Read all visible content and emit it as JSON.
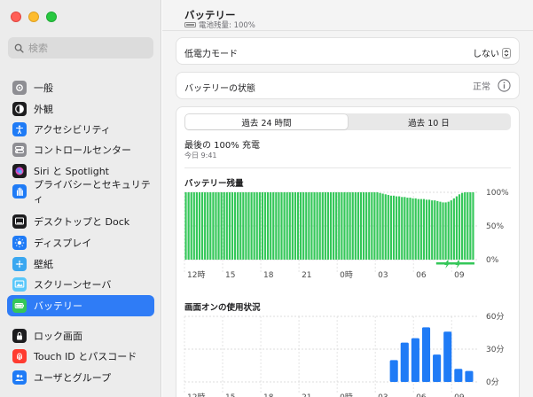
{
  "sidebar": {
    "search_placeholder": "検索",
    "items": [
      {
        "label": "一般",
        "icon": "gear-icon",
        "color": "#8e8e93"
      },
      {
        "label": "外観",
        "icon": "appearance-icon",
        "color": "#1d1d1f"
      },
      {
        "label": "アクセシビリティ",
        "icon": "accessibility-icon",
        "color": "#1f7bf6"
      },
      {
        "label": "コントロールセンター",
        "icon": "control-center-icon",
        "color": "#8e8e93"
      },
      {
        "label": "Siri と Spotlight",
        "icon": "siri-icon",
        "color": "#b03bd9"
      },
      {
        "label": "プライバシーとセキュリティ",
        "icon": "hand-icon",
        "color": "#1f7bf6"
      },
      {
        "label": "デスクトップと Dock",
        "icon": "dock-icon",
        "color": "#1d1d1f"
      },
      {
        "label": "ディスプレイ",
        "icon": "display-icon",
        "color": "#1f7bf6"
      },
      {
        "label": "壁紙",
        "icon": "wallpaper-icon",
        "color": "#3aa7f0"
      },
      {
        "label": "スクリーンセーバ",
        "icon": "screensaver-icon",
        "color": "#5ac8fa"
      },
      {
        "label": "バッテリー",
        "icon": "battery-icon",
        "color": "#34c759",
        "active": true
      },
      {
        "label": "ロック画面",
        "icon": "lock-icon",
        "color": "#1d1d1f"
      },
      {
        "label": "Touch ID とパスコード",
        "icon": "fingerprint-icon",
        "color": "#ff3b30"
      },
      {
        "label": "ユーザとグループ",
        "icon": "users-icon",
        "color": "#1f7bf6"
      }
    ]
  },
  "header": {
    "title": "バッテリー",
    "subtitle": "電池残量: 100%"
  },
  "low_power": {
    "label": "低電力モード",
    "value": "しない"
  },
  "health": {
    "label": "バッテリーの状態",
    "value": "正常"
  },
  "tabs": [
    "過去 24 時間",
    "過去 10 日"
  ],
  "last_charge": {
    "label": "最後の 100% 充電",
    "time": "今日 9:41"
  },
  "chart_data": [
    {
      "type": "bar",
      "title": "バッテリー残量",
      "x_tick_labels": [
        "12時",
        "15",
        "18",
        "21",
        "0時",
        "03",
        "06",
        "09"
      ],
      "y_tick_labels": [
        "100%",
        "50%",
        "0%"
      ],
      "ylim": [
        0,
        100
      ],
      "color": "#34c759",
      "charging_color": "#34c759",
      "values": [
        100,
        100,
        100,
        100,
        100,
        100,
        100,
        100,
        100,
        100,
        100,
        100,
        100,
        100,
        100,
        100,
        100,
        100,
        100,
        100,
        100,
        100,
        100,
        100,
        100,
        100,
        100,
        100,
        100,
        100,
        100,
        100,
        100,
        100,
        100,
        100,
        100,
        100,
        100,
        100,
        100,
        100,
        100,
        100,
        100,
        100,
        100,
        100,
        100,
        100,
        100,
        100,
        100,
        100,
        100,
        100,
        100,
        100,
        100,
        100,
        100,
        100,
        100,
        100,
        100,
        100,
        100,
        100,
        100,
        100,
        100,
        99,
        98,
        97,
        96,
        95,
        95,
        94,
        94,
        93,
        93,
        92,
        92,
        91,
        91,
        90,
        90,
        90,
        89,
        89,
        88,
        88,
        87,
        86,
        85,
        85,
        86,
        88,
        91,
        94,
        97,
        99,
        100,
        100,
        100,
        100
      ]
    },
    {
      "type": "bar",
      "title": "画面オンの使用状況",
      "x_tick_labels": [
        "12時",
        "15",
        "18",
        "21",
        "0時",
        "03",
        "06",
        "09"
      ],
      "y_tick_labels": [
        "60分",
        "30分",
        "0分"
      ],
      "ylim": [
        0,
        60
      ],
      "color": "#1f7bf6",
      "values": [
        0,
        0,
        0,
        0,
        0,
        0,
        0,
        0,
        0,
        0,
        0,
        0,
        0,
        0,
        0,
        0,
        0,
        0,
        0,
        20,
        36,
        40,
        50,
        25,
        46,
        12,
        10
      ]
    }
  ]
}
